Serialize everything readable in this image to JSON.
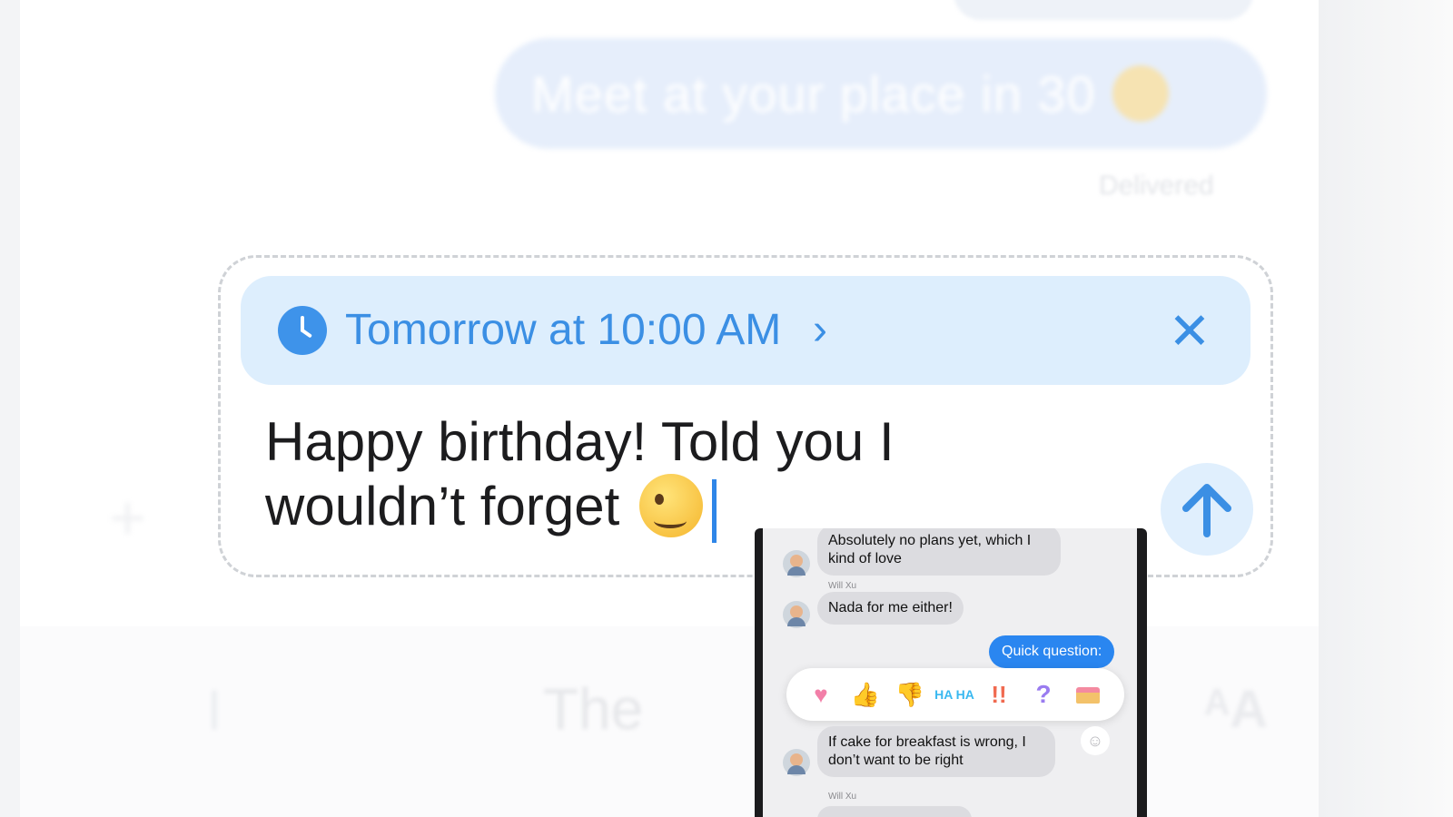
{
  "background": {
    "blurred_message": "Meet at your place in 30",
    "blurred_status": "Delivered",
    "suggestion_word": "The"
  },
  "composer": {
    "schedule_label": "Tomorrow at 10:00 AM",
    "schedule_chevron": "›",
    "close_symbol": "✕",
    "message_text": "Happy birthday! Told you I wouldn’t forget",
    "send_icon": "arrow-up-icon",
    "accent_color": "#3b8fe4"
  },
  "inset": {
    "messages": [
      {
        "type": "incoming",
        "text": "Absolutely no plans yet, which I kind of love"
      },
      {
        "type": "name",
        "text": "Will Xu"
      },
      {
        "type": "incoming",
        "text": "Nada for me either!"
      },
      {
        "type": "outgoing",
        "text": "Quick question:"
      },
      {
        "type": "incoming",
        "text": "If cake for breakfast is wrong, I don’t want to be right"
      },
      {
        "type": "name",
        "text": "Will Xu"
      }
    ],
    "tapbacks": {
      "heart": "♥",
      "thumbs_up": "👍",
      "thumbs_down": "👎",
      "haha": "HA HA",
      "exclamation": "!!",
      "question": "?"
    }
  }
}
